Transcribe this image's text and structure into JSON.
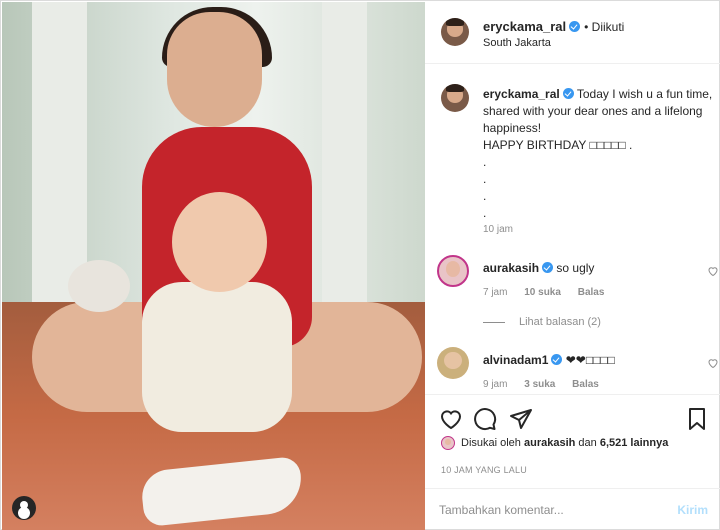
{
  "post": {
    "author": "eryckama_ral",
    "follow_status": "• Diikuti",
    "location": "South Jakarta"
  },
  "caption": {
    "author": "eryckama_ral",
    "text": "Today I wish u a fun time, shared with your dear ones and a lifelong happiness!",
    "line2": "HAPPY BIRTHDAY □□□□□ .",
    "dots": [
      ".",
      ".",
      ".",
      "."
    ],
    "time": "10 jam"
  },
  "comments": [
    {
      "user": "aurakasih",
      "text": "so ugly",
      "time": "7 jam",
      "likes": "10 suka",
      "reply": "Balas",
      "view_replies": "Lihat balasan (2)"
    },
    {
      "user": "alvinadam1",
      "text": "❤❤□□□□",
      "time": "9 jam",
      "likes": "3 suka",
      "reply": "Balas"
    }
  ],
  "likes": {
    "prefix": "Disukai oleh",
    "user": "aurakasih",
    "connector": "dan",
    "others": "6,521 lainnya"
  },
  "posted_ago": "10 JAM YANG LALU",
  "add_comment": {
    "placeholder": "Tambahkan komentar...",
    "send_label": "Kirim"
  },
  "colors": {
    "verified": "#3897f0",
    "send_disabled": "#b2dffc",
    "muted": "#8e8e8e"
  }
}
